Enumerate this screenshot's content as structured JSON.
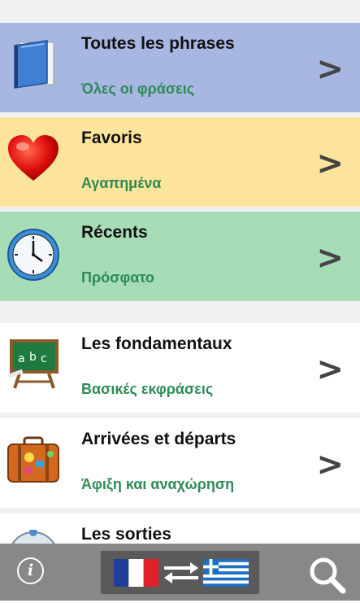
{
  "menu": {
    "all_phrases": {
      "title": "Toutes les phrases",
      "subtitle": "Όλες οι φράσεις",
      "bg": "#a8b6e2"
    },
    "favorites": {
      "title": "Favoris",
      "subtitle": "Αγαπημένα",
      "bg": "#fde49c"
    },
    "recents": {
      "title": "Récents",
      "subtitle": "Πρόσφατο",
      "bg": "#a6dcb6"
    }
  },
  "categories": [
    {
      "title": "Les fondamentaux",
      "subtitle": "Βασικές εκφράσεις",
      "icon": "chalkboard-icon"
    },
    {
      "title": "Arrivées et départs",
      "subtitle": "Άφιξη και αναχώρηση",
      "icon": "suitcase-icon"
    },
    {
      "title": "Les sorties",
      "subtitle": "",
      "icon": "compass-icon"
    }
  ],
  "chevron": ">",
  "bottom_bar": {
    "info_glyph": "i",
    "icons": {
      "info": "info-icon",
      "source_flag": "french-flag-icon",
      "swap": "swap-arrows-icon",
      "target_flag": "greek-flag-icon",
      "search": "search-icon"
    }
  },
  "colors": {
    "subtitle": "#2e8b57",
    "bottom_bar": "#888888",
    "accent_title": "#111111"
  }
}
